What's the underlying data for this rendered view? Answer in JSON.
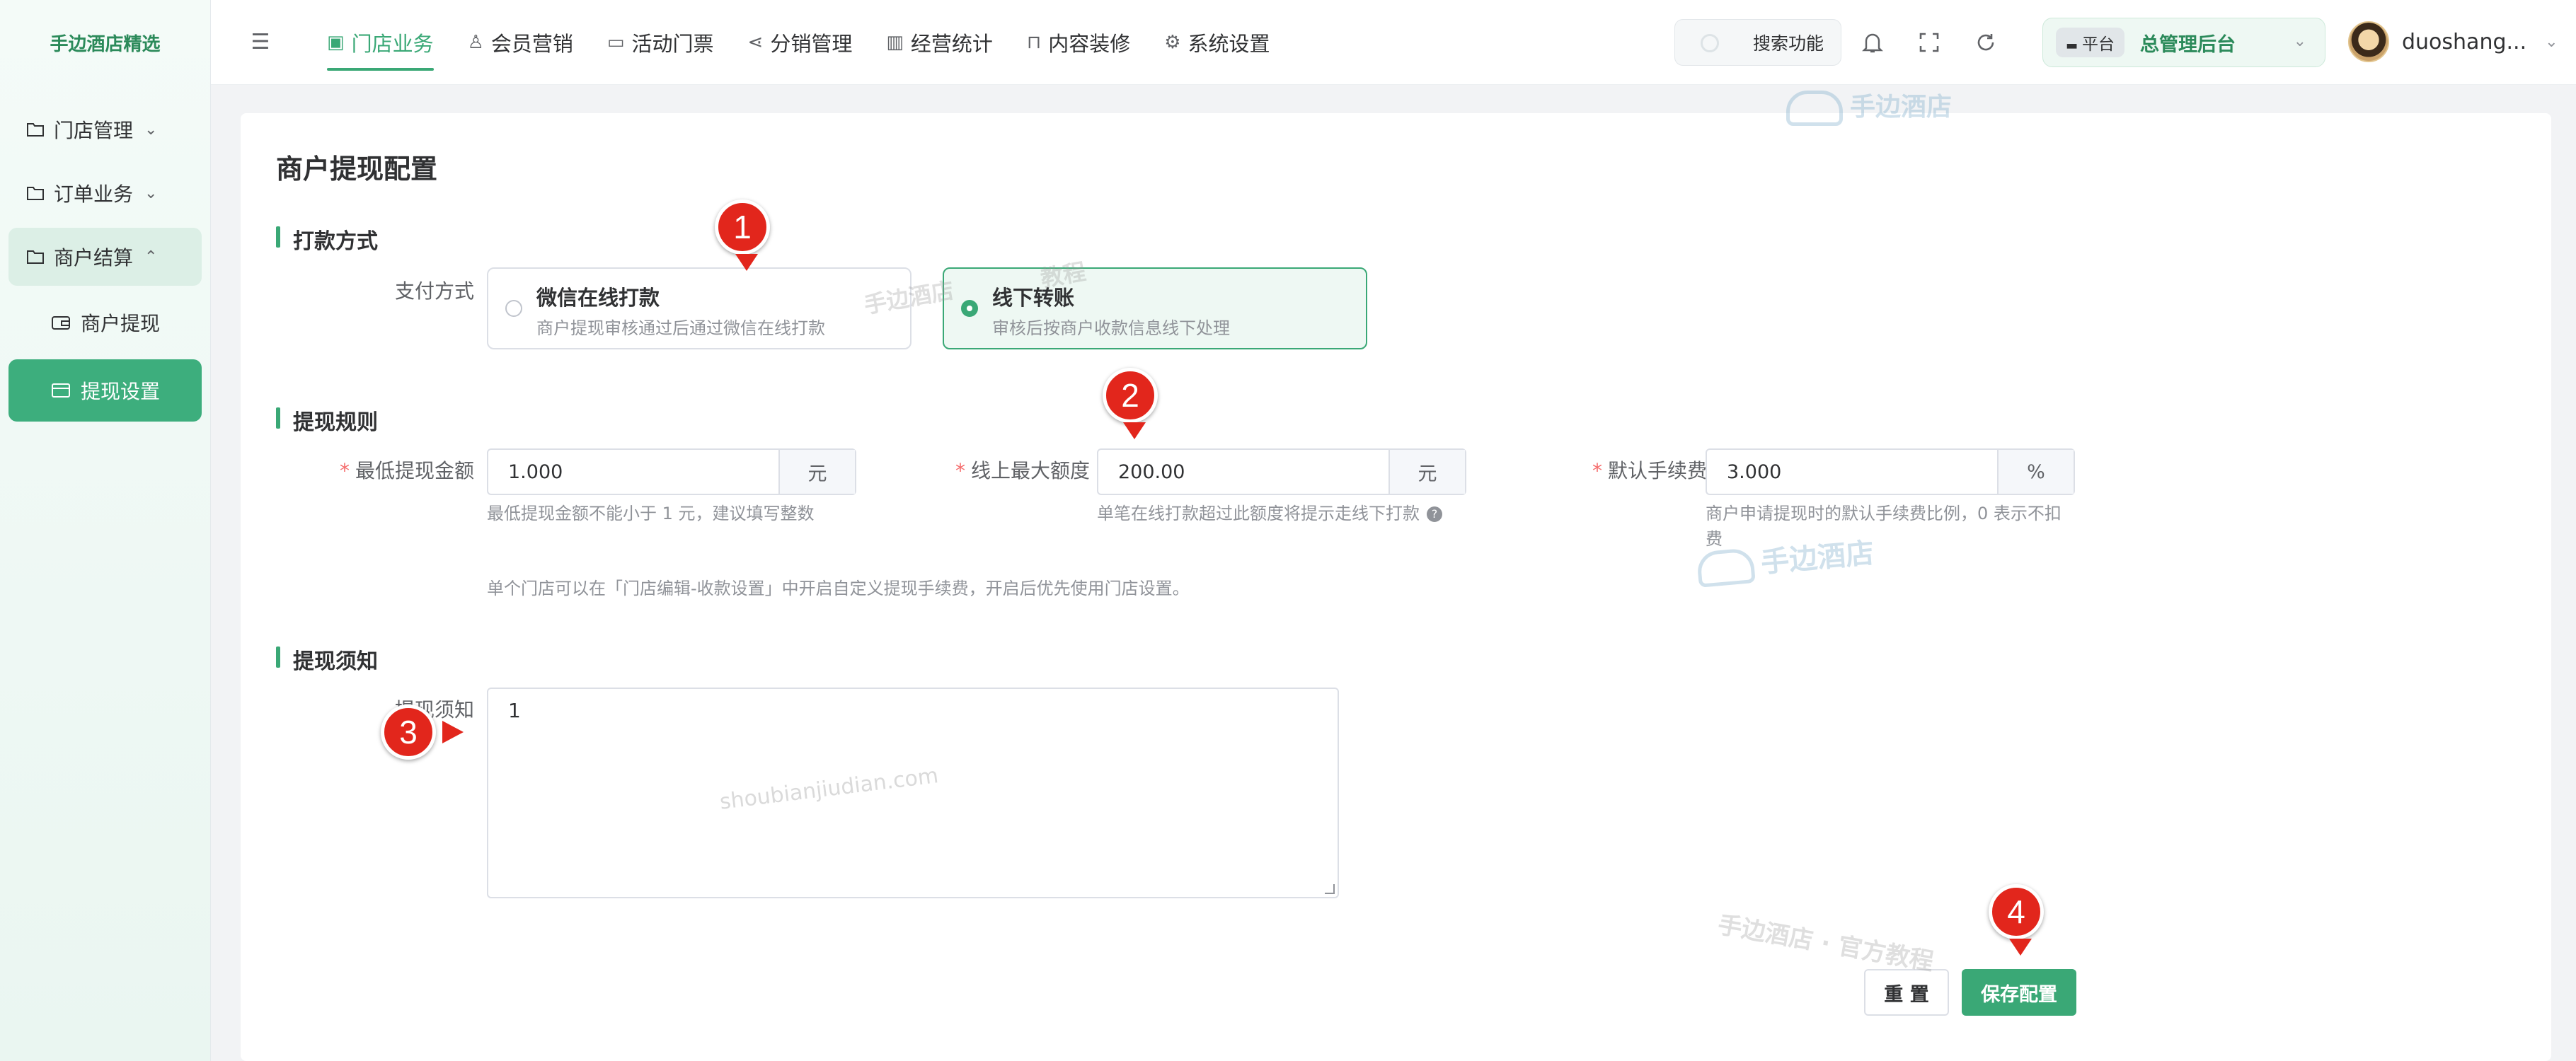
{
  "sidebar": {
    "brand": "手边酒店精选",
    "items": [
      {
        "label": "门店管理"
      },
      {
        "label": "订单业务"
      },
      {
        "label": "商户结算"
      }
    ],
    "subitems": [
      {
        "label": "商户提现"
      },
      {
        "label": "提现设置"
      }
    ]
  },
  "topbar": {
    "tabs": [
      {
        "label": "门店业务"
      },
      {
        "label": "会员营销"
      },
      {
        "label": "活动门票"
      },
      {
        "label": "分销管理"
      },
      {
        "label": "经营统计"
      },
      {
        "label": "内容装修"
      },
      {
        "label": "系统设置"
      }
    ],
    "search_label": "搜索功能",
    "platform_tag": "平台",
    "platform_name": "总管理后台",
    "username": "duoshang..."
  },
  "page": {
    "title": "商户提现配置",
    "sections": {
      "payment": "打款方式",
      "rules": "提现规则",
      "notice": "提现须知"
    },
    "payment_label": "支付方式",
    "options": [
      {
        "title": "微信在线打款",
        "desc": "商户提现审核通过后通过微信在线打款",
        "selected": false
      },
      {
        "title": "线下转账",
        "desc": "审核后按商户收款信息线下处理",
        "selected": true
      }
    ],
    "rules": {
      "min_label": "最低提现金额",
      "min_value": "1.000",
      "min_unit": "元",
      "min_hint": "最低提现金额不能小于 1 元，建议填写整数",
      "max_label": "线上最大额度",
      "max_value": "200.00",
      "max_unit": "元",
      "max_hint": "单笔在线打款超过此额度将提示走线下打款",
      "fee_label": "默认手续费",
      "fee_value": "3.000",
      "fee_unit": "%",
      "fee_hint_1": "商户申请提现时的默认手续费比例，0 表示不扣",
      "fee_hint_2": "费",
      "store_note": "单个门店可以在「门店编辑-收款设置」中开启自定义提现手续费，开启后优先使用门店设置。"
    },
    "notice_label": "提现须知",
    "notice_value": "1",
    "reset_label": "重 置",
    "save_label": "保存配置"
  },
  "watermarks": {
    "brand": "手边酒店",
    "tutorial": "手边酒店 · 官方教程",
    "domain": "shoubianjiudian.com",
    "faded_1": "手边酒店",
    "faded_2": "教程"
  },
  "markers": [
    "1",
    "2",
    "3",
    "4"
  ],
  "colors": {
    "accent": "#3aa876",
    "marker": "#e2261c"
  }
}
